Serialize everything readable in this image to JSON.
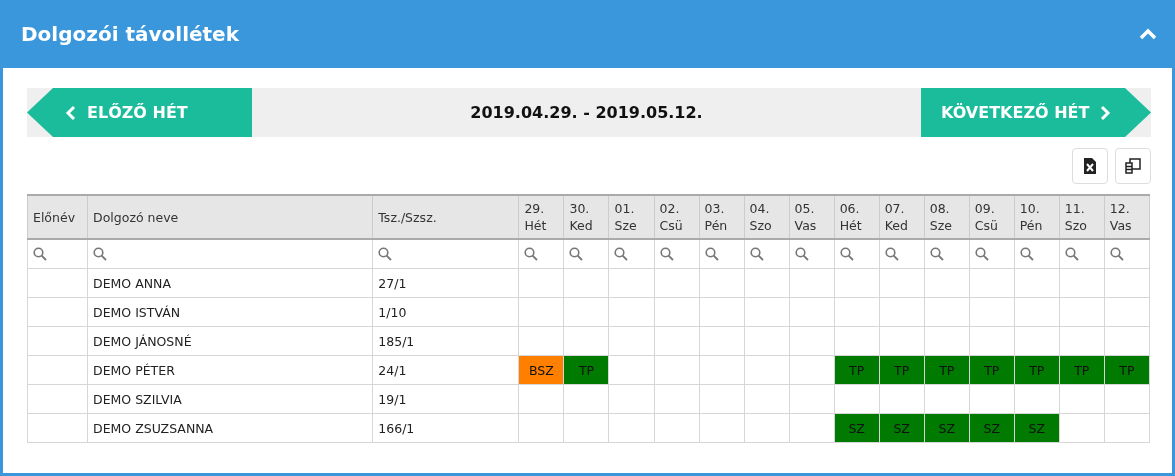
{
  "panel": {
    "title": "Dolgozói távollétek"
  },
  "nav": {
    "prev": "ELŐZŐ HÉT",
    "range": "2019.04.29. - 2019.05.12.",
    "next": "KÖVETKEZŐ HÉT"
  },
  "table": {
    "columns": [
      "Előnév",
      "Dolgozó neve",
      "Tsz./Szsz."
    ],
    "days": [
      {
        "num": "29.",
        "name": "Hét"
      },
      {
        "num": "30.",
        "name": "Ked"
      },
      {
        "num": "01.",
        "name": "Sze"
      },
      {
        "num": "02.",
        "name": "Csü"
      },
      {
        "num": "03.",
        "name": "Pén"
      },
      {
        "num": "04.",
        "name": "Szo"
      },
      {
        "num": "05.",
        "name": "Vas"
      },
      {
        "num": "06.",
        "name": "Hét"
      },
      {
        "num": "07.",
        "name": "Ked"
      },
      {
        "num": "08.",
        "name": "Sze"
      },
      {
        "num": "09.",
        "name": "Csü"
      },
      {
        "num": "10.",
        "name": "Pén"
      },
      {
        "num": "11.",
        "name": "Szo"
      },
      {
        "num": "12.",
        "name": "Vas"
      }
    ],
    "rows": [
      {
        "name": "DEMO ANNA",
        "id": "27/1",
        "cells": [
          {
            "kind": "empty"
          },
          {
            "kind": "empty"
          },
          {
            "kind": "empty"
          },
          {
            "kind": "empty"
          },
          {
            "kind": "empty"
          },
          {
            "kind": "empty"
          },
          {
            "kind": "empty"
          },
          {
            "kind": "empty"
          },
          {
            "kind": "empty"
          },
          {
            "kind": "empty"
          },
          {
            "kind": "empty"
          },
          {
            "kind": "empty"
          },
          {
            "kind": "empty"
          },
          {
            "kind": "empty"
          }
        ]
      },
      {
        "name": "DEMO ISTVÁN",
        "id": "1/10",
        "cells": [
          {
            "kind": "empty"
          },
          {
            "kind": "empty"
          },
          {
            "kind": "empty"
          },
          {
            "kind": "empty"
          },
          {
            "kind": "empty"
          },
          {
            "kind": "empty"
          },
          {
            "kind": "empty"
          },
          {
            "kind": "empty"
          },
          {
            "kind": "empty"
          },
          {
            "kind": "empty"
          },
          {
            "kind": "empty"
          },
          {
            "kind": "empty"
          },
          {
            "kind": "empty"
          },
          {
            "kind": "empty"
          }
        ]
      },
      {
        "name": "DEMO JÁNOSNÉ",
        "id": "185/1",
        "cells": [
          {
            "kind": "empty"
          },
          {
            "kind": "empty"
          },
          {
            "kind": "empty"
          },
          {
            "kind": "empty"
          },
          {
            "kind": "empty"
          },
          {
            "kind": "empty"
          },
          {
            "kind": "empty"
          },
          {
            "kind": "empty"
          },
          {
            "kind": "empty"
          },
          {
            "kind": "empty"
          },
          {
            "kind": "empty"
          },
          {
            "kind": "empty"
          },
          {
            "kind": "empty"
          },
          {
            "kind": "empty"
          }
        ]
      },
      {
        "name": "DEMO PÉTER",
        "id": "24/1",
        "cells": [
          {
            "kind": "absence",
            "code": "BSZ",
            "color": "#ff7f00"
          },
          {
            "kind": "absence",
            "code": "TP",
            "color": "#007a00"
          },
          {
            "kind": "empty"
          },
          {
            "kind": "empty"
          },
          {
            "kind": "empty"
          },
          {
            "kind": "empty"
          },
          {
            "kind": "empty"
          },
          {
            "kind": "absence",
            "code": "TP",
            "color": "#007a00"
          },
          {
            "kind": "absence",
            "code": "TP",
            "color": "#007a00"
          },
          {
            "kind": "absence",
            "code": "TP",
            "color": "#007a00"
          },
          {
            "kind": "absence",
            "code": "TP",
            "color": "#007a00"
          },
          {
            "kind": "absence",
            "code": "TP",
            "color": "#007a00"
          },
          {
            "kind": "absence",
            "code": "TP",
            "color": "#007a00"
          },
          {
            "kind": "absence",
            "code": "TP",
            "color": "#007a00"
          }
        ]
      },
      {
        "name": "DEMO SZILVIA",
        "id": "19/1",
        "cells": [
          {
            "kind": "empty"
          },
          {
            "kind": "empty"
          },
          {
            "kind": "empty"
          },
          {
            "kind": "empty"
          },
          {
            "kind": "empty"
          },
          {
            "kind": "empty"
          },
          {
            "kind": "empty"
          },
          {
            "kind": "empty"
          },
          {
            "kind": "empty"
          },
          {
            "kind": "empty"
          },
          {
            "kind": "empty"
          },
          {
            "kind": "empty"
          },
          {
            "kind": "empty"
          },
          {
            "kind": "empty"
          }
        ]
      },
      {
        "name": "DEMO ZSUZSANNA",
        "id": "166/1",
        "cells": [
          {
            "kind": "empty"
          },
          {
            "kind": "empty"
          },
          {
            "kind": "empty"
          },
          {
            "kind": "empty"
          },
          {
            "kind": "empty"
          },
          {
            "kind": "empty"
          },
          {
            "kind": "empty"
          },
          {
            "kind": "absence",
            "code": "SZ",
            "color": "#007a00"
          },
          {
            "kind": "absence",
            "code": "SZ",
            "color": "#007a00"
          },
          {
            "kind": "absence",
            "code": "SZ",
            "color": "#007a00"
          },
          {
            "kind": "absence",
            "code": "SZ",
            "color": "#007a00"
          },
          {
            "kind": "absence",
            "code": "SZ",
            "color": "#007a00"
          },
          {
            "kind": "empty"
          },
          {
            "kind": "empty"
          }
        ]
      }
    ]
  }
}
